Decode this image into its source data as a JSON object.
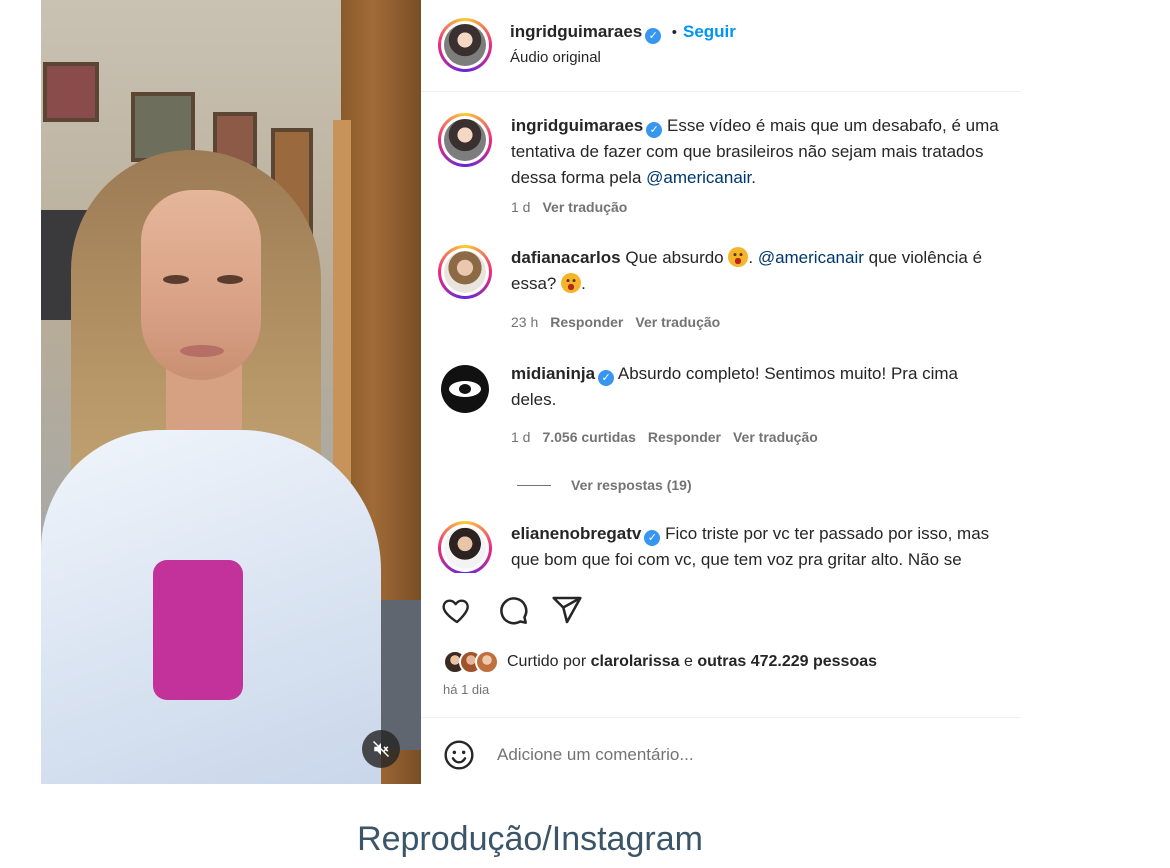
{
  "post": {
    "author": "ingridguimaraes",
    "follow_label": "Seguir",
    "audio_label": "Áudio original",
    "separator": "•"
  },
  "comments": [
    {
      "username": "ingridguimaraes",
      "verified": true,
      "line1": "Esse vídeo é mais que um desabafo, é uma",
      "line2": "tentativa de fazer com que brasileiros não sejam mais tratados",
      "line3_pre": "dessa forma pela ",
      "line3_mention": "@americanair",
      "line3_post": ".",
      "time": "1 d",
      "translate": "Ver tradução"
    },
    {
      "username": "dafianacarlos",
      "verified": false,
      "line1_pre": "Que absurdo ",
      "line1_mid": ". ",
      "line1_mention": "@americanair",
      "line1_post": " que violência é",
      "line2_pre": "essa? ",
      "line2_post": ".",
      "time": "23 h",
      "reply": "Responder",
      "translate": "Ver tradução"
    },
    {
      "username": "midianinja",
      "verified": true,
      "line1": "Absurdo completo! Sentimos muito! Pra cima",
      "line2": "deles.",
      "time": "1 d",
      "likes": "7.056 curtidas",
      "reply": "Responder",
      "translate": "Ver tradução",
      "view_replies": "Ver respostas (19)"
    },
    {
      "username": "elianenobregatv",
      "verified": true,
      "line1": "Fico triste por vc ter passado por isso, mas",
      "line2": "que bom que foi com vc, que tem voz pra gritar alto. Não se"
    }
  ],
  "liked_by": {
    "prefix": "Curtido por ",
    "user": "clarolarissa",
    "middle": " e ",
    "others": "outras 472.229 pessoas"
  },
  "posted_ago": "há 1 dia",
  "add_comment_placeholder": "Adicione um comentário...",
  "caption": "Reprodução/Instagram",
  "colors": {
    "link_blue": "#0095f6",
    "verified_blue": "#3797f0",
    "mention": "#00376b",
    "muted": "#737373"
  },
  "icons": [
    "mute-icon",
    "verified-icon",
    "heart-icon",
    "comment-icon",
    "share-icon",
    "emoji-icon"
  ]
}
